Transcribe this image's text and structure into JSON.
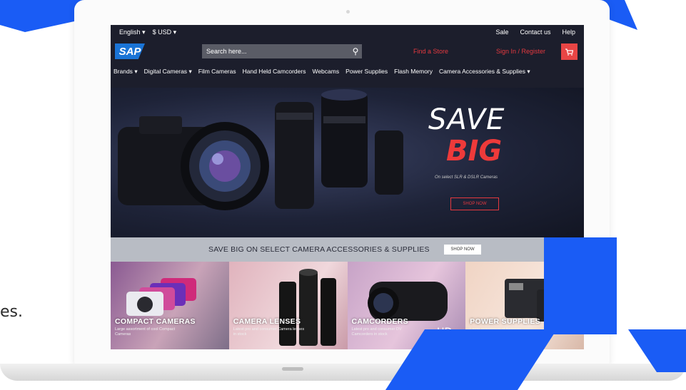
{
  "side_text": "es.",
  "topbar": {
    "language": "English",
    "currency": "$ USD",
    "links": [
      "Sale",
      "Contact us",
      "Help"
    ]
  },
  "header": {
    "logo": "SAP",
    "search_placeholder": "Search here...",
    "find_store": "Find a Store",
    "sign_in": "Sign In / Register"
  },
  "nav": {
    "items": [
      "Brands",
      "Digital Cameras",
      "Film Cameras",
      "Hand Held Camcorders",
      "Webcams",
      "Power Supplies",
      "Flash Memory",
      "Camera Accessories & Supplies"
    ]
  },
  "hero": {
    "line1": "SAVE",
    "line2": "BIG",
    "subtitle": "On select SLR & DSLR Cameras",
    "button": "SHOP NOW"
  },
  "promo": {
    "text": "SAVE BIG ON SELECT CAMERA ACCESSORIES & SUPPLIES",
    "button": "SHOP NOW"
  },
  "tiles": [
    {
      "title": "COMPACT CAMERAS",
      "subtitle": "Large assortment of cool Compact Cameras"
    },
    {
      "title": "CAMERA LENSES",
      "subtitle": "Latest pro and consumer Camera lenses in stock"
    },
    {
      "title": "CAMCORDERS",
      "subtitle": "Latest pro and consumer DV Camcorders in stock"
    },
    {
      "title": "POWER SUPPLIES",
      "subtitle": "Large assortment of Batteries"
    }
  ],
  "colors": {
    "accent_blue": "#1a5cf5",
    "brand_red": "#e4393f",
    "nav_bg": "#1c1e2c"
  }
}
